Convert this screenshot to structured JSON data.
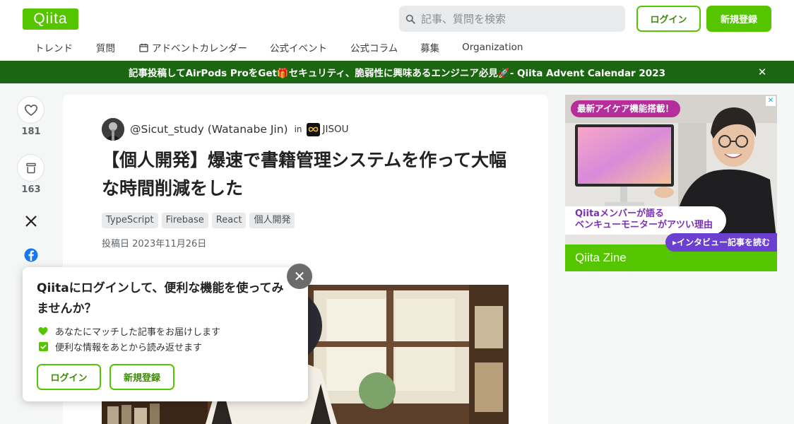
{
  "header": {
    "logo": "Qiita",
    "search_placeholder": "記事、質問を検索",
    "login_label": "ログイン",
    "signup_label": "新規登録",
    "nav": [
      "トレンド",
      "質問",
      "アドベントカレンダー",
      "公式イベント",
      "公式コラム",
      "募集",
      "Organization"
    ]
  },
  "banner": {
    "text": "記事投稿してAirPods ProをGet🎁セキュリティ、脆弱性に興味あるエンジニア必見🚀- Qiita Advent Calendar 2023",
    "close": "✕"
  },
  "rail": {
    "like_count": "181",
    "stock_count": "163"
  },
  "article": {
    "author": "@Sicut_study (Watanabe Jin)",
    "in_label": "in",
    "org": "JISOU",
    "title": "【個人開発】爆速で書籍管理システムを作って大幅な時間削減をした",
    "tags": [
      "TypeScript",
      "Firebase",
      "React",
      "個人開発"
    ],
    "posted": "投稿日 2023年11月26日"
  },
  "ad": {
    "pill": "最新アイケア機能搭載！",
    "caption_line1": "Qiitaメンバーが語る",
    "caption_line2": "ベンキューモニターがアツい理由",
    "cta": "▸インタビュー記事を読む",
    "footer": "Qiita Zine"
  },
  "popup": {
    "title": "Qiitaにログインして、便利な機能を使ってみませんか？",
    "features": [
      "あなたにマッチした記事をお届けします",
      "便利な情報をあとから読み返せます"
    ],
    "login_label": "ログイン",
    "signup_label": "新規登録",
    "close": "✕"
  },
  "colors": {
    "brand": "#55c500",
    "brand_dark": "#3e8b06",
    "banner": "#1b6711"
  }
}
